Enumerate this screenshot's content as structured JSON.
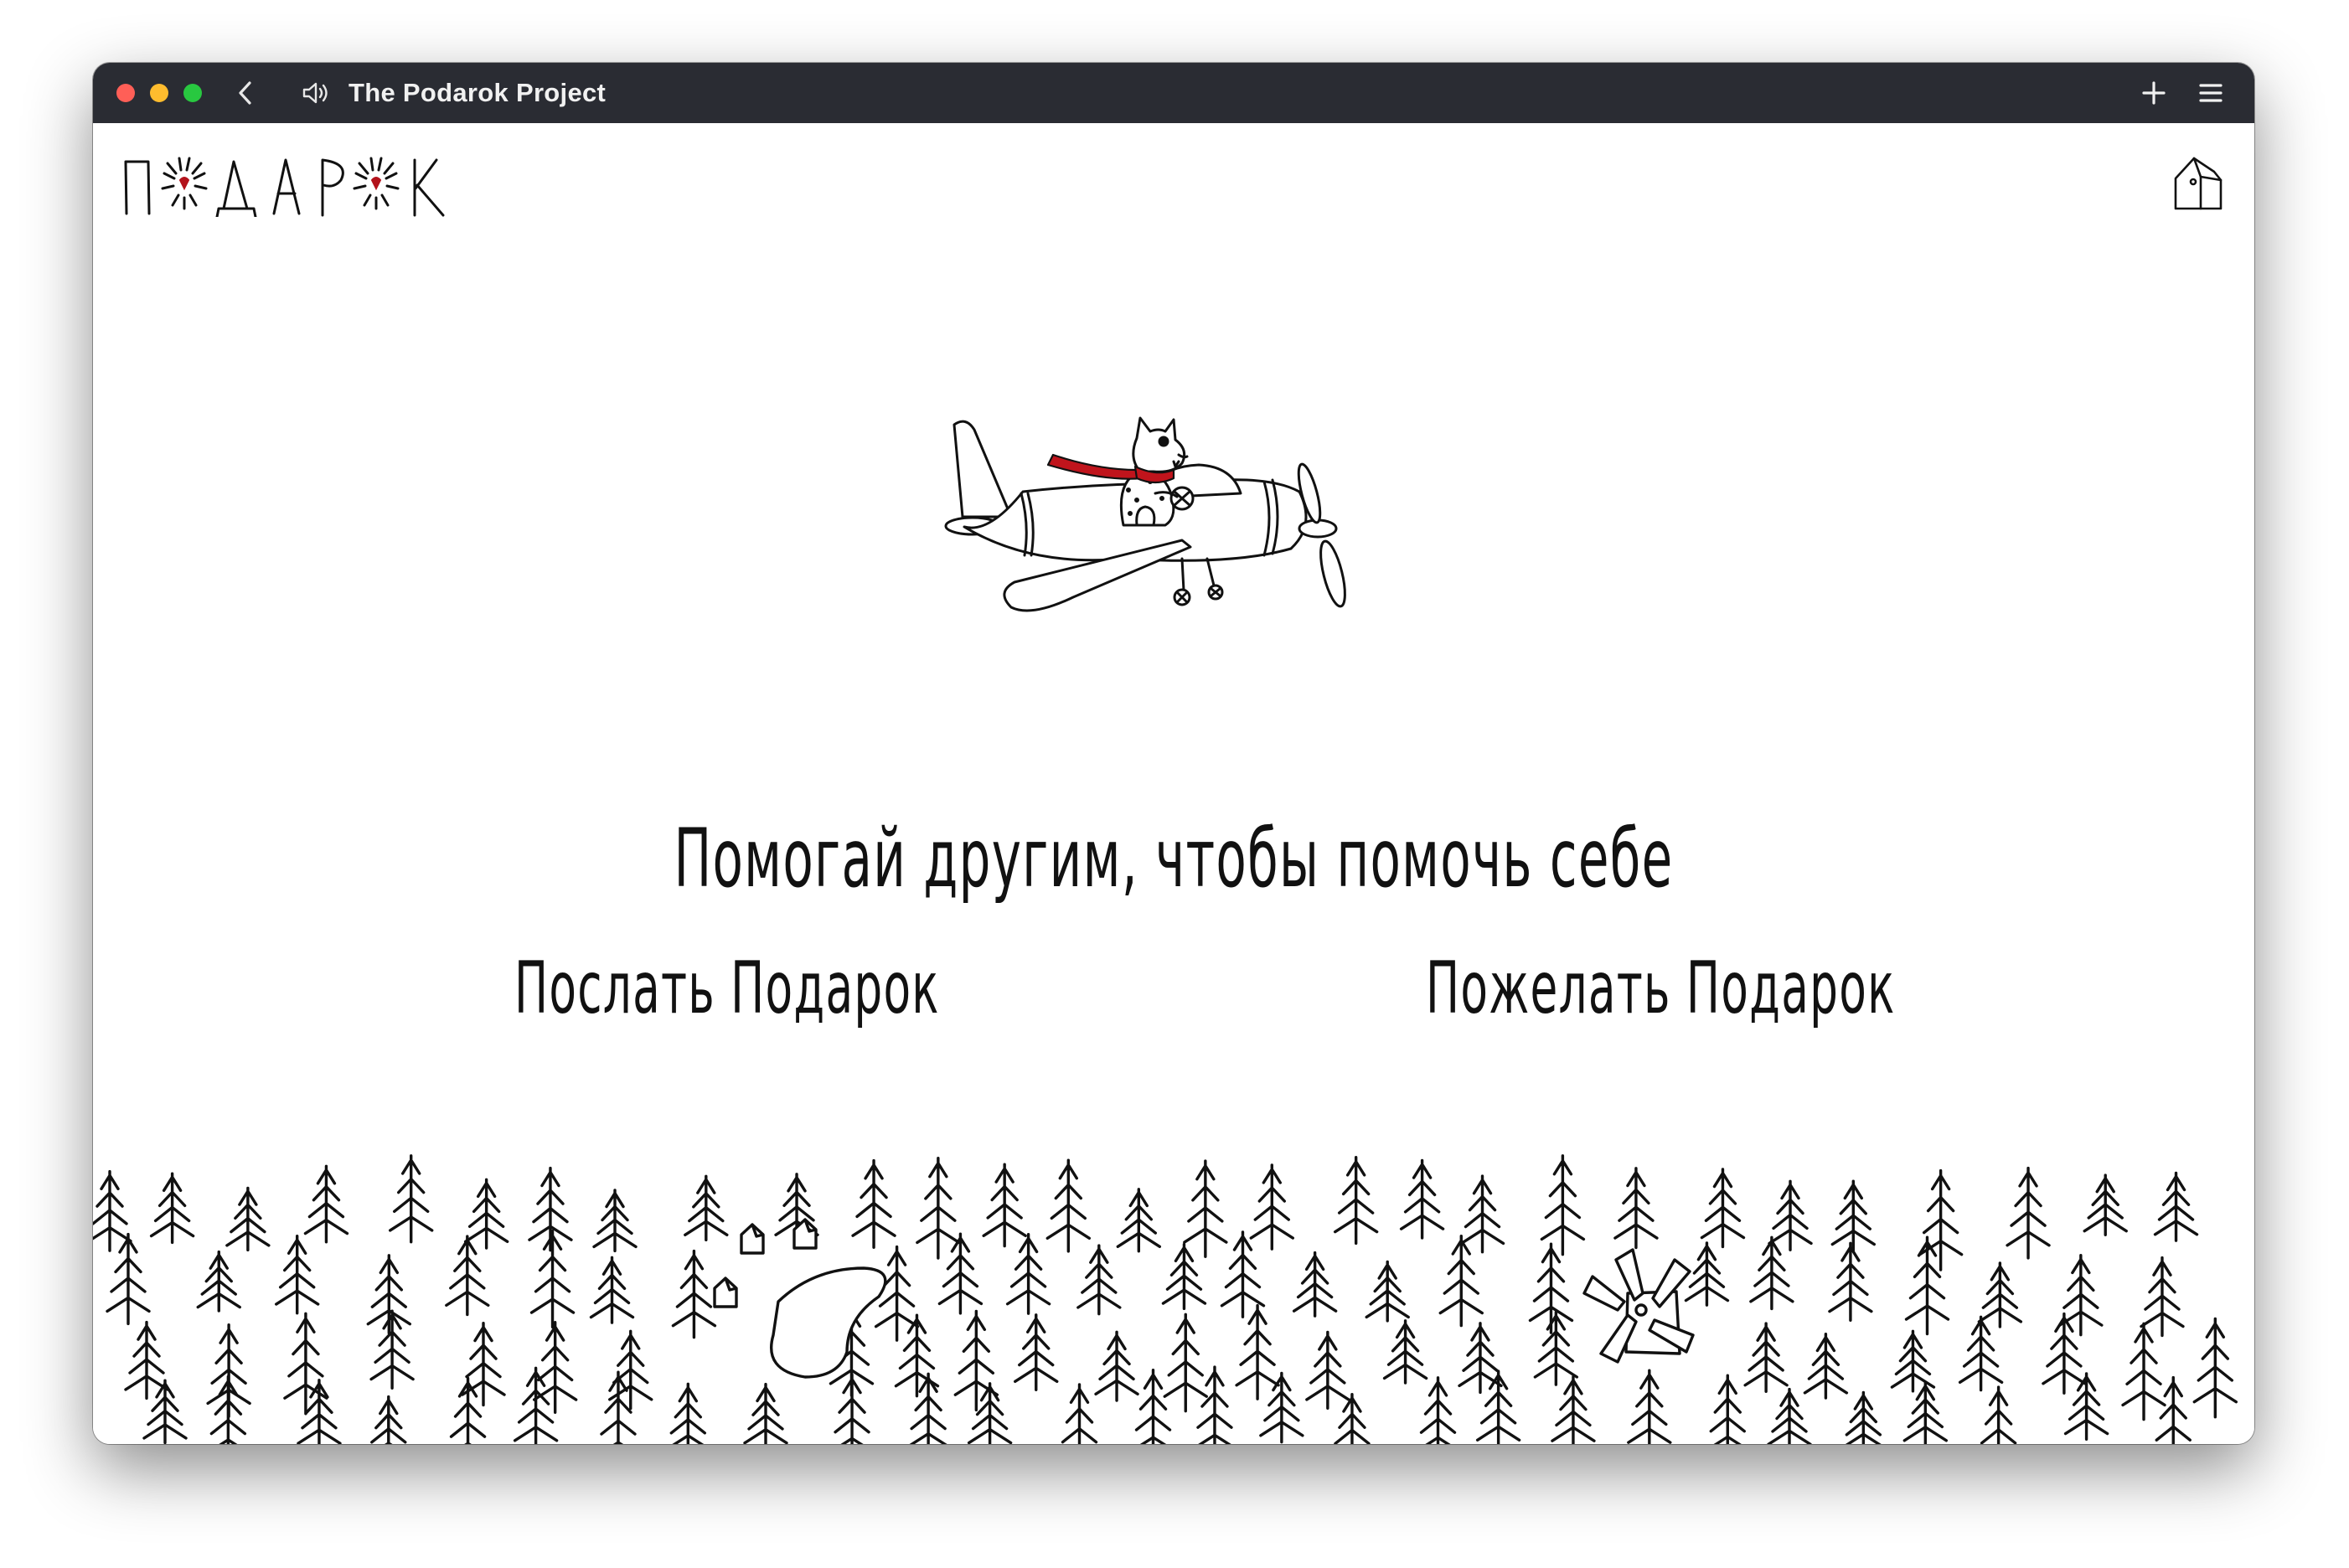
{
  "window": {
    "title": "The Podarok Project",
    "traffic_lights": [
      "close",
      "minimize",
      "zoom"
    ],
    "icons": [
      "chevron-left-icon",
      "speaker-icon",
      "plus-icon",
      "hamburger-menu-icon"
    ]
  },
  "header": {
    "logo_text": "ПОДАРОК",
    "home_icon": "house-icon",
    "logo_heart_color": "#b3121b"
  },
  "hero": {
    "illustration": "airplane-with-cat-pilot",
    "scarf_color": "#c0141c",
    "slogan": "Помогай другим, чтобы помочь себе"
  },
  "actions": {
    "send_label": "Послать Подарок",
    "wish_label": "Пожелать Подарок"
  },
  "footer": {
    "illustration": "forest-with-houses-pond-and-windmill"
  }
}
